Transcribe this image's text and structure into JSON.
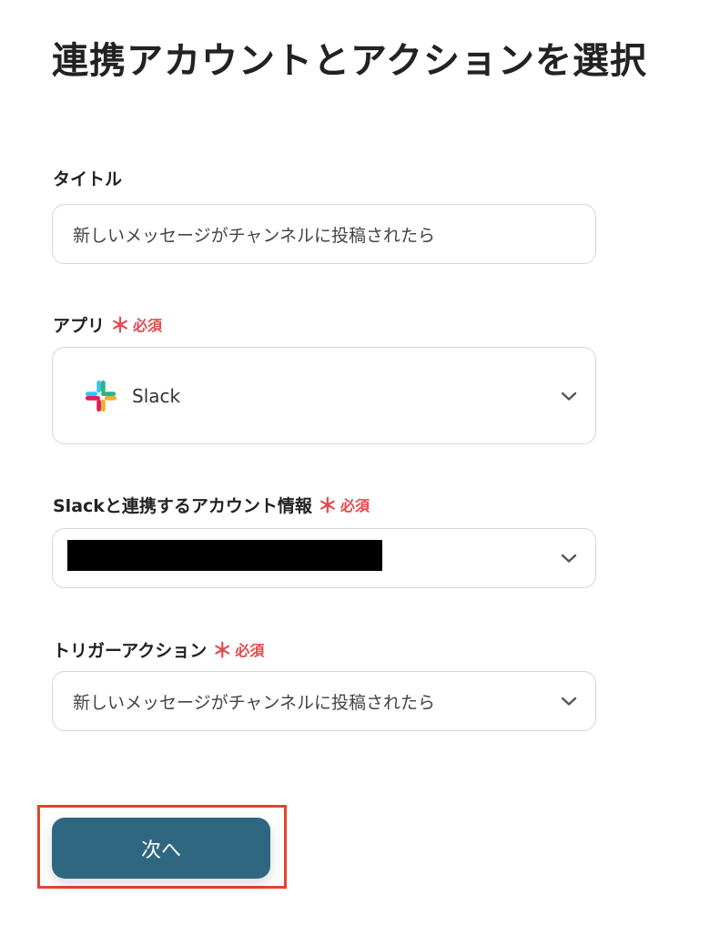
{
  "page": {
    "title": "連携アカウントとアクションを選択"
  },
  "form": {
    "title_field": {
      "label": "タイトル",
      "value": "新しいメッセージがチャンネルに投稿されたら"
    },
    "app_field": {
      "label": "アプリ",
      "required_mark": "＊",
      "required_text": "必須",
      "value": "Slack",
      "icon": "slack-logo-icon"
    },
    "account_field": {
      "label": "Slackと連携するアカウント情報",
      "required_mark": "＊",
      "required_text": "必須",
      "value_redacted": true
    },
    "trigger_field": {
      "label": "トリガーアクション",
      "required_mark": "＊",
      "required_text": "必須",
      "value": "新しいメッセージがチャンネルに投稿されたら"
    }
  },
  "actions": {
    "next_label": "次へ"
  },
  "colors": {
    "primary_button": "#2f6781",
    "required": "#e5484d",
    "highlight_border": "#e2442f"
  }
}
